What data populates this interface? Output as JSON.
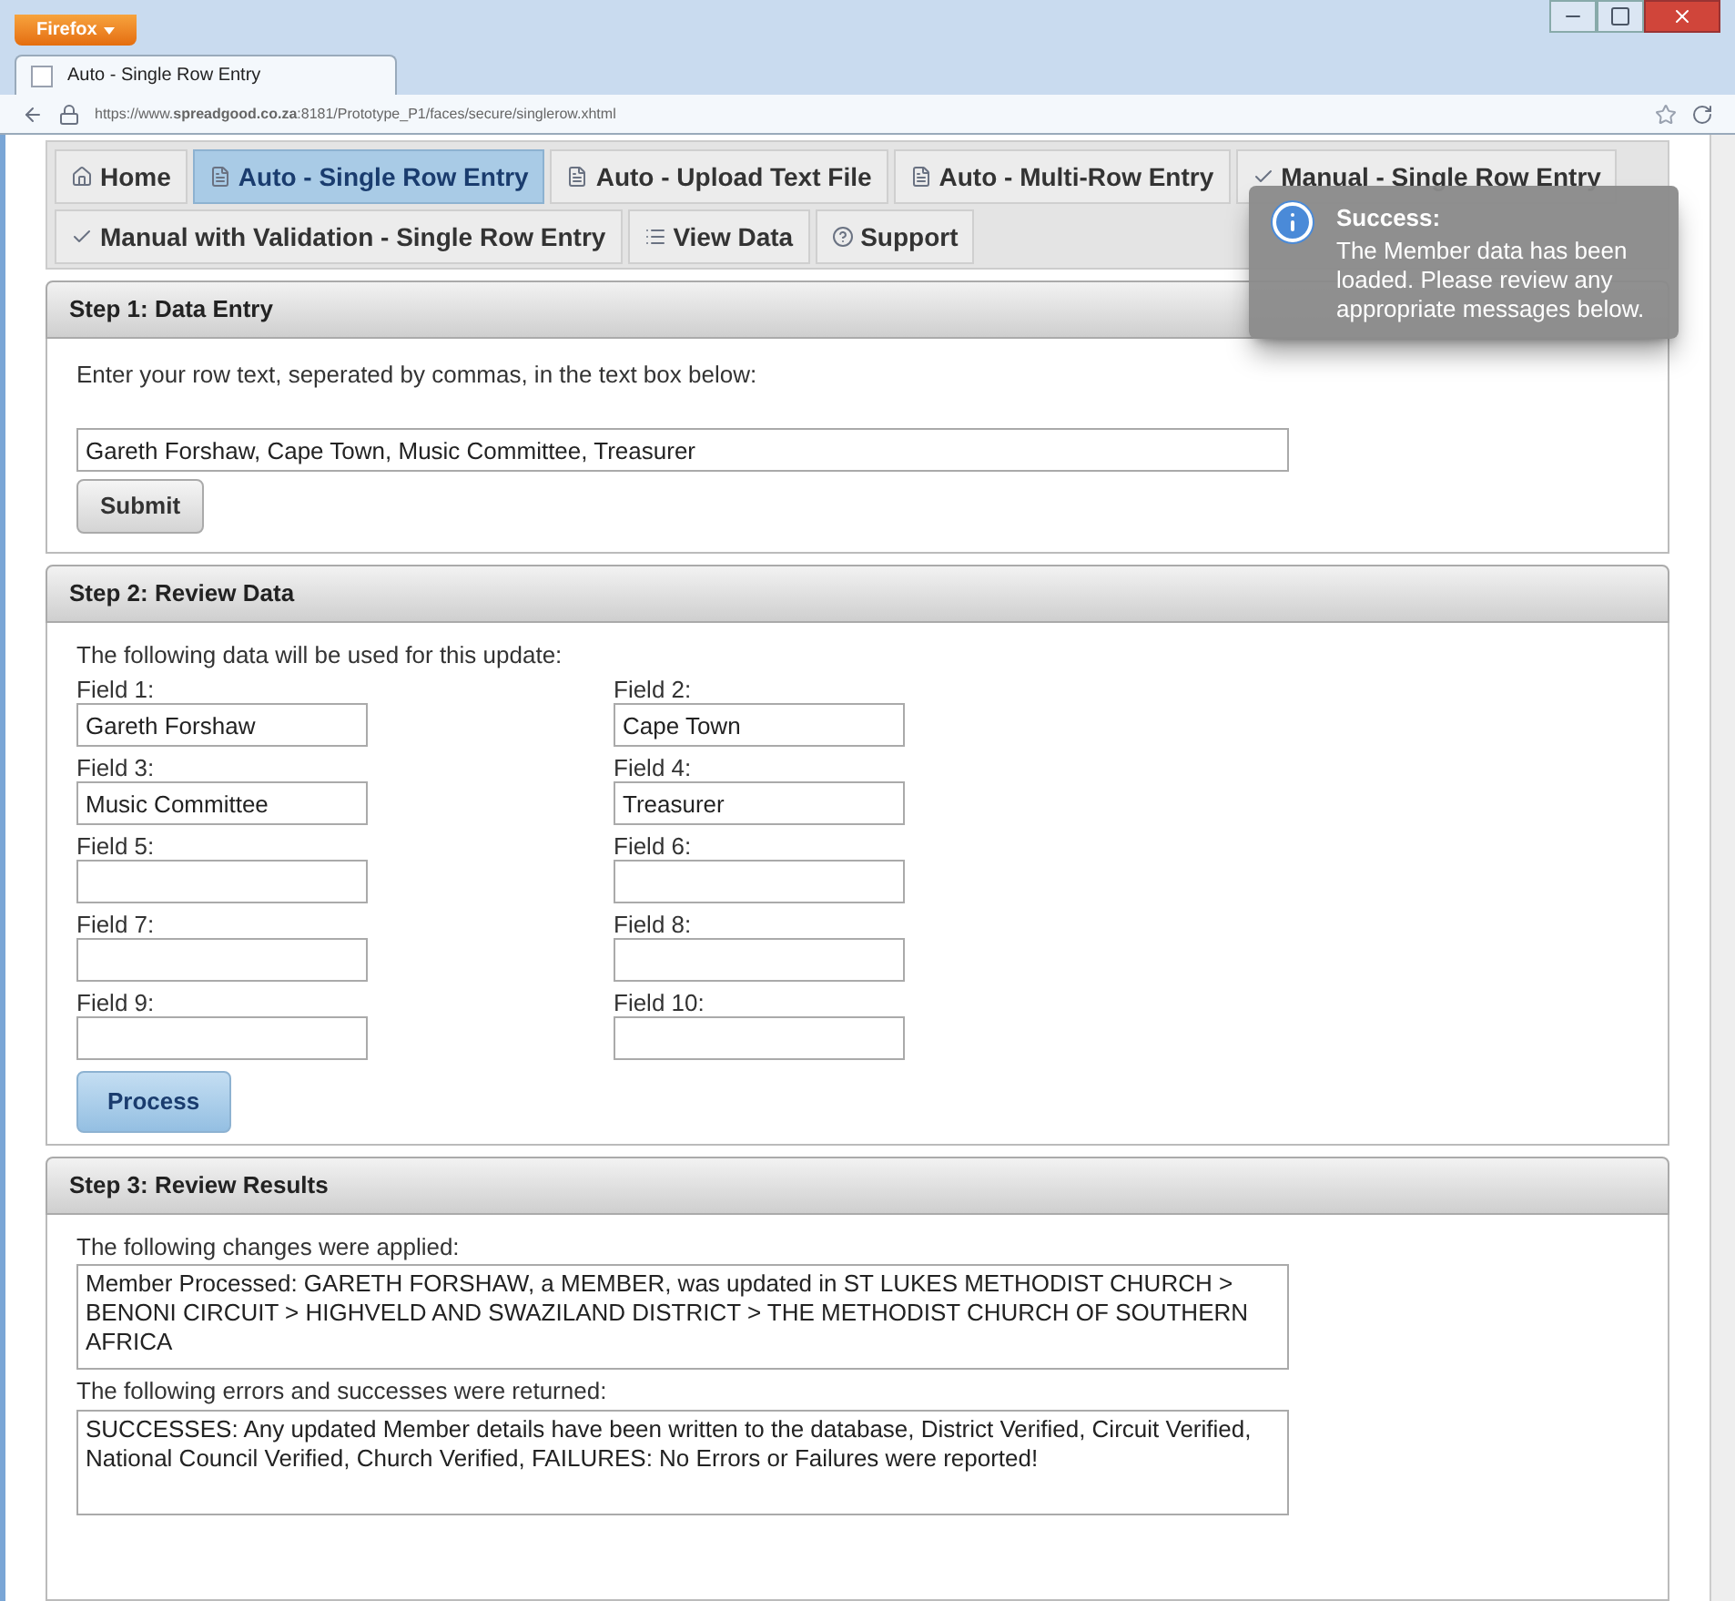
{
  "browser": {
    "menu_button": "Firefox",
    "tab_title": "Auto - Single Row Entry",
    "url": "https://www.**spreadgood.co.za**:8181/Prototype_P1/faces/secure/singlerow.xhtml"
  },
  "nav": [
    [
      {
        "label": "Home",
        "kind": "home",
        "selected": false
      },
      {
        "label": "Auto - Single Row Entry",
        "kind": "auto",
        "selected": true
      },
      {
        "label": "Auto - Upload Text File",
        "kind": "auto",
        "selected": false
      },
      {
        "label": "Auto - Multi-Row Entry",
        "kind": "auto",
        "selected": false
      },
      {
        "label": "Manual - Single Row Entry",
        "kind": "manual",
        "selected": false
      }
    ],
    [
      {
        "label": "Manual with Validation - Single Row Entry",
        "kind": "manual",
        "selected": false
      },
      {
        "label": "View Data",
        "kind": "view",
        "selected": false
      },
      {
        "label": "Support",
        "kind": "support",
        "selected": false
      }
    ]
  ],
  "toast": {
    "title": "Success:",
    "message": "The Member data has been loaded. Please review any appropriate messages below."
  },
  "step1": {
    "title": "Step 1: Data Entry",
    "instruction": "Enter your row text, seperated by commas, in the text box below:",
    "value": "Gareth Forshaw, Cape Town, Music Committee, Treasurer",
    "button": "Submit"
  },
  "step2": {
    "title": "Step 2: Review Data",
    "intro": "The following data will be used for this update:",
    "fields": [
      {
        "label": "Field 1:",
        "value": "Gareth Forshaw"
      },
      {
        "label": "Field 2:",
        "value": "Cape Town"
      },
      {
        "label": "Field 3:",
        "value": "Music Committee"
      },
      {
        "label": "Field 4:",
        "value": "Treasurer"
      },
      {
        "label": "Field 5:"
      },
      {
        "label": "Field 6:"
      },
      {
        "label": "Field 7:"
      },
      {
        "label": "Field 8:"
      },
      {
        "label": "Field 9:"
      },
      {
        "label": "Field 10:"
      }
    ],
    "button": "Process"
  },
  "step3": {
    "title": "Step 3: Review Results",
    "changes_label": "The following changes were applied:",
    "changes": "Member Processed: GARETH FORSHAW, a MEMBER, was updated in ST LUKES METHODIST CHURCH >  BENONI CIRCUIT >  HIGHVELD AND SWAZILAND DISTRICT >  THE METHODIST CHURCH OF SOUTHERN AFRICA",
    "errors_label": "The following errors and successes were returned:",
    "errors": "SUCCESSES: Any updated Member details have been written to the database, District Verified, Circuit Verified, National Council Verified, Church Verified, FAILURES: No Errors or Failures were reported!"
  }
}
